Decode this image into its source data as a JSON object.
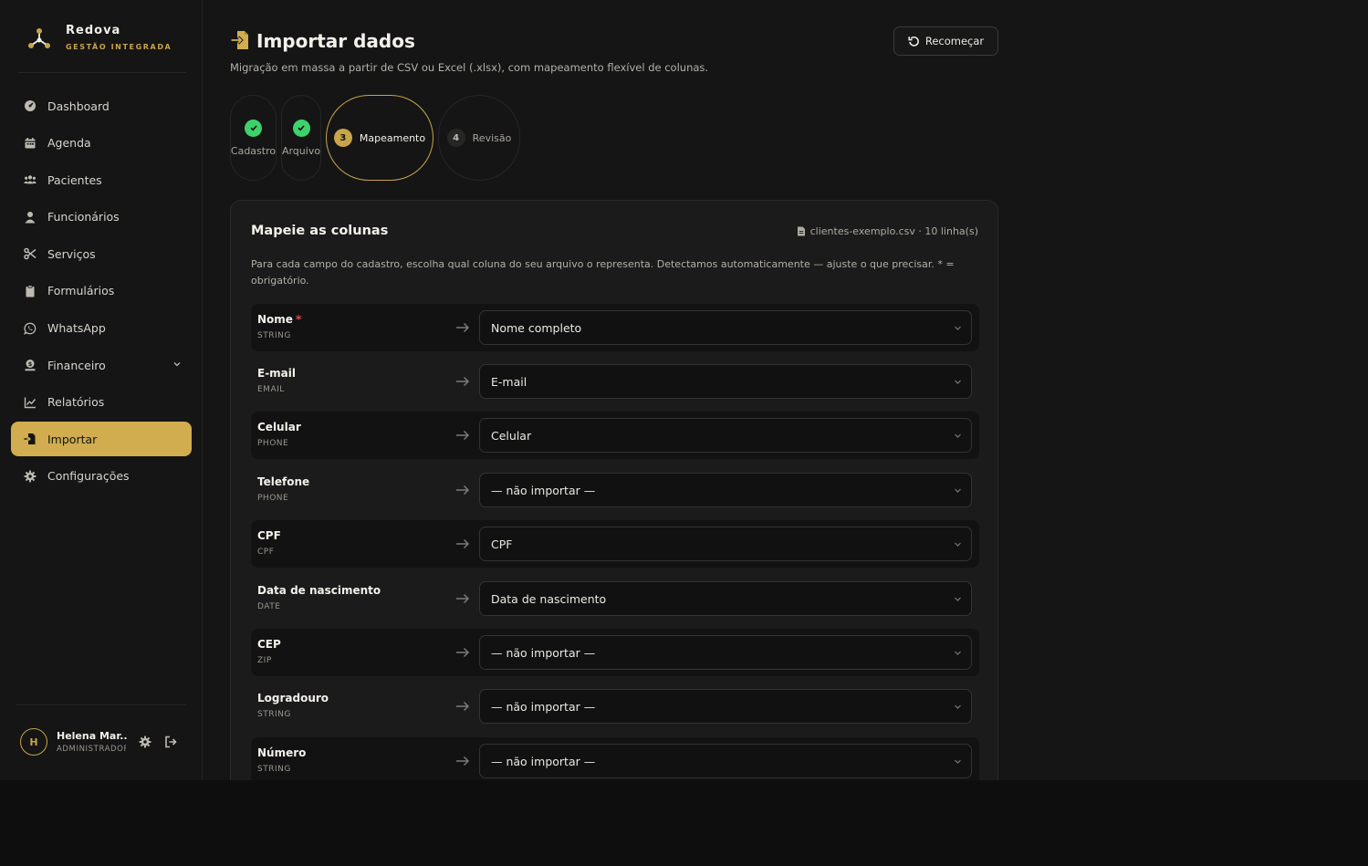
{
  "brand": {
    "name": "Redova",
    "tagline": "GESTÃO INTEGRADA"
  },
  "nav": [
    {
      "label": "Dashboard",
      "icon": "dashboard-icon"
    },
    {
      "label": "Agenda",
      "icon": "calendar-icon"
    },
    {
      "label": "Pacientes",
      "icon": "users-icon"
    },
    {
      "label": "Funcionários",
      "icon": "user-icon"
    },
    {
      "label": "Serviços",
      "icon": "scissors-icon"
    },
    {
      "label": "Formulários",
      "icon": "clipboard-icon"
    },
    {
      "label": "WhatsApp",
      "icon": "whatsapp-icon"
    },
    {
      "label": "Financeiro",
      "icon": "money-icon",
      "expandable": true
    },
    {
      "label": "Relatórios",
      "icon": "chart-icon"
    },
    {
      "label": "Importar",
      "icon": "import-icon",
      "active": true
    },
    {
      "label": "Configurações",
      "icon": "gear-icon"
    }
  ],
  "user": {
    "initial": "H",
    "name": "Helena Mar...",
    "role": "ADMINISTRADOR"
  },
  "page": {
    "title": "Importar dados",
    "subtitle": "Migração em massa a partir de CSV ou Excel (.xlsx), com mapeamento flexível de colunas.",
    "restart_label": "Recomeçar"
  },
  "steps": [
    {
      "label": "Cadastro",
      "status": "done"
    },
    {
      "label": "Arquivo",
      "status": "done"
    },
    {
      "number": "3",
      "label": "Mapeamento",
      "status": "current"
    },
    {
      "number": "4",
      "label": "Revisão",
      "status": "todo"
    }
  ],
  "mapping": {
    "title": "Mapeie as colunas",
    "file_info": "clientes-exemplo.csv · 10 linha(s)",
    "description": "Para cada campo do cadastro, escolha qual coluna do seu arquivo o representa. Detectamos automaticamente — ajuste o que precisar. * = obrigatório.",
    "rows": [
      {
        "field": "Nome",
        "required": "*",
        "type": "STRING",
        "value": "Nome completo"
      },
      {
        "field": "E-mail",
        "type": "EMAIL",
        "value": "E-mail"
      },
      {
        "field": "Celular",
        "type": "PHONE",
        "value": "Celular"
      },
      {
        "field": "Telefone",
        "type": "PHONE",
        "value": "— não importar —"
      },
      {
        "field": "CPF",
        "type": "CPF",
        "value": "CPF"
      },
      {
        "field": "Data de nascimento",
        "type": "DATE",
        "value": "Data de nascimento"
      },
      {
        "field": "CEP",
        "type": "ZIP",
        "value": "— não importar —"
      },
      {
        "field": "Logradouro",
        "type": "STRING",
        "value": "— não importar —"
      },
      {
        "field": "Número",
        "type": "STRING",
        "value": "— não importar —"
      }
    ]
  },
  "colors": {
    "accent": "#d1ad4f",
    "success": "#3dd26c",
    "background": "#151515"
  }
}
